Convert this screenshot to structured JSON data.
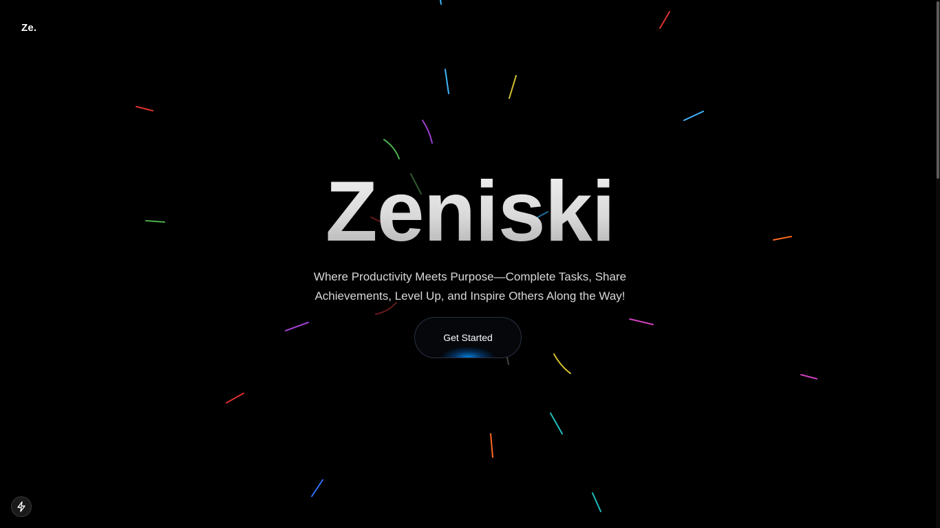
{
  "header": {
    "logo_text": "Ze."
  },
  "hero": {
    "title": "Zeniski",
    "subtitle": "Where Productivity Meets Purpose—Complete Tasks, Share Achievements, Level Up, and Inspire Others Along the Way!",
    "cta_label": "Get Started"
  },
  "floating_button": {
    "icon": "bolt-icon"
  },
  "colors": {
    "background": "#000000",
    "accent_glow": "#0096ff",
    "streaks": [
      "#e03030",
      "#3fb8ff",
      "#d4c030",
      "#a040d0",
      "#4caf50",
      "#ff6a20",
      "#d040c0",
      "#20c0c0",
      "#3070ff"
    ]
  }
}
